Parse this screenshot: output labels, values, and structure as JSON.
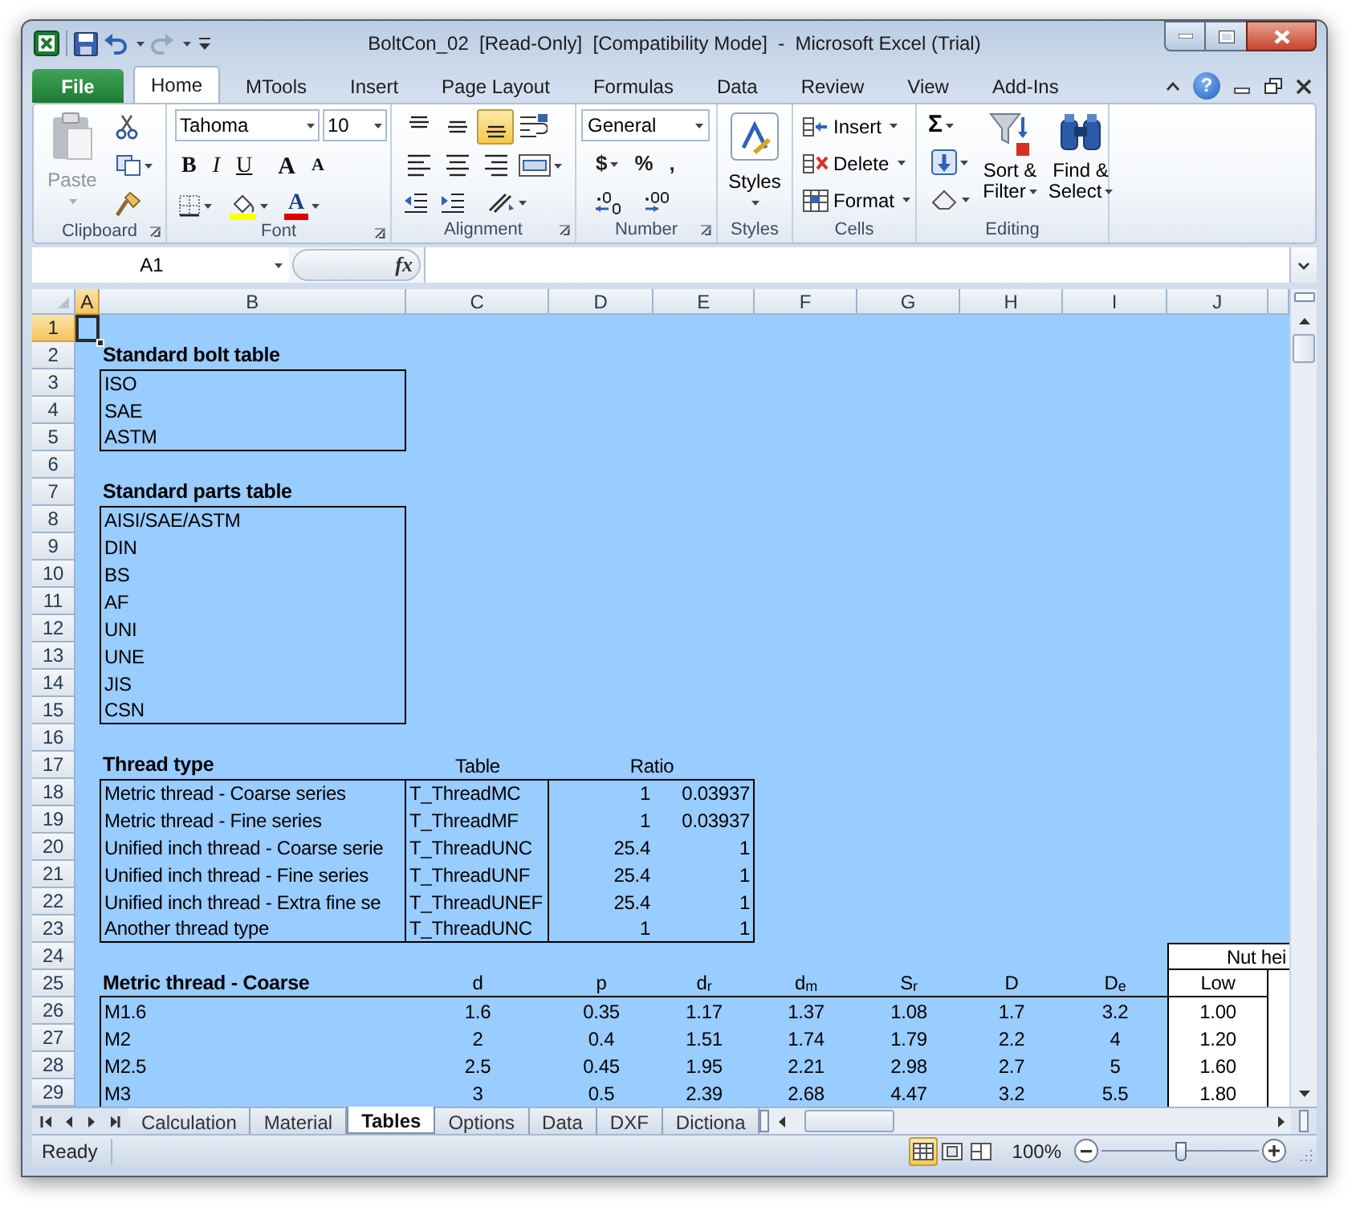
{
  "window": {
    "title": "BoltCon_02  [Read-Only]  [Compatibility Mode]  -  Microsoft Excel (Trial)"
  },
  "ribbon_tabs": [
    {
      "label": "File",
      "kind": "file",
      "selected": false
    },
    {
      "label": "Home",
      "kind": "tab",
      "selected": true
    },
    {
      "label": "MTools",
      "kind": "tab",
      "selected": false
    },
    {
      "label": "Insert",
      "kind": "tab",
      "selected": false
    },
    {
      "label": "Page Layout",
      "kind": "tab",
      "selected": false
    },
    {
      "label": "Formulas",
      "kind": "tab",
      "selected": false
    },
    {
      "label": "Data",
      "kind": "tab",
      "selected": false
    },
    {
      "label": "Review",
      "kind": "tab",
      "selected": false
    },
    {
      "label": "View",
      "kind": "tab",
      "selected": false
    },
    {
      "label": "Add-Ins",
      "kind": "tab",
      "selected": false
    }
  ],
  "help_button": "?",
  "ribbon": {
    "groups": [
      {
        "label": "Clipboard"
      },
      {
        "label": "Font"
      },
      {
        "label": "Alignment"
      },
      {
        "label": "Number"
      },
      {
        "label": "Styles"
      },
      {
        "label": "Cells"
      },
      {
        "label": "Editing"
      }
    ],
    "paste": {
      "label": "Paste",
      "disabled": true
    },
    "font_name": "Tahoma",
    "font_size": "10",
    "font_buttons": [
      {
        "label": "B",
        "kind": "bold"
      },
      {
        "label": "I",
        "kind": "italic"
      },
      {
        "label": "U",
        "kind": "underline"
      },
      {
        "label": "A",
        "kind": "grow"
      },
      {
        "label": "A",
        "kind": "shrink"
      }
    ],
    "font_color_button": "A",
    "vertical_align": [
      {
        "kind": "top",
        "on": false
      },
      {
        "kind": "middle",
        "on": false
      },
      {
        "kind": "bottom",
        "on": true
      }
    ],
    "number_format": "General",
    "number_buttons": [
      {
        "label": "$",
        "kind": "currency"
      },
      {
        "label": "%",
        "kind": "percent"
      },
      {
        "label": ",",
        "kind": "comma"
      }
    ],
    "styles": "Styles",
    "cells_buttons": [
      {
        "label": "Insert",
        "kind": "insert"
      },
      {
        "label": "Delete",
        "kind": "delete"
      },
      {
        "label": "Format",
        "kind": "format"
      }
    ],
    "sum_button": "Σ",
    "editing_buttons": [
      {
        "label": "Sort & Filter",
        "kind": "sort"
      },
      {
        "label": "Find & Select",
        "kind": "find"
      }
    ]
  },
  "formula_bar": {
    "name_box": "A1",
    "function_label": "fx"
  },
  "columns": [
    {
      "label": "A",
      "selected": true
    },
    {
      "label": "B",
      "selected": false
    },
    {
      "label": "C",
      "selected": false
    },
    {
      "label": "D",
      "selected": false
    },
    {
      "label": "E",
      "selected": false
    },
    {
      "label": "F",
      "selected": false
    },
    {
      "label": "G",
      "selected": false
    },
    {
      "label": "H",
      "selected": false
    },
    {
      "label": "I",
      "selected": false
    },
    {
      "label": "J",
      "selected": false
    }
  ],
  "rows": [
    {
      "number": "1",
      "selected": true
    },
    {
      "number": "2",
      "selected": false,
      "B": {
        "text": "Standard bolt table",
        "bold": true
      }
    },
    {
      "number": "3",
      "selected": false,
      "B": {
        "text": "ISO"
      }
    },
    {
      "number": "4",
      "selected": false,
      "B": {
        "text": "SAE"
      }
    },
    {
      "number": "5",
      "selected": false,
      "B": {
        "text": "ASTM"
      }
    },
    {
      "number": "6",
      "selected": false
    },
    {
      "number": "7",
      "selected": false,
      "B": {
        "text": "Standard parts table",
        "bold": true
      }
    },
    {
      "number": "8",
      "selected": false,
      "B": {
        "text": "AISI/SAE/ASTM"
      }
    },
    {
      "number": "9",
      "selected": false,
      "B": {
        "text": "DIN"
      }
    },
    {
      "number": "10",
      "selected": false,
      "B": {
        "text": "BS"
      }
    },
    {
      "number": "11",
      "selected": false,
      "B": {
        "text": "AF"
      }
    },
    {
      "number": "12",
      "selected": false,
      "B": {
        "text": "UNI"
      }
    },
    {
      "number": "13",
      "selected": false,
      "B": {
        "text": "UNE"
      }
    },
    {
      "number": "14",
      "selected": false,
      "B": {
        "text": "JIS"
      }
    },
    {
      "number": "15",
      "selected": false,
      "B": {
        "text": "CSN"
      }
    },
    {
      "number": "16",
      "selected": false
    },
    {
      "number": "17",
      "selected": false,
      "B": {
        "text": "Thread type",
        "bold": true
      },
      "C": {
        "text": "Table",
        "centered": true
      },
      "D": {
        "text": "Ratio",
        "centered": true,
        "merged": true
      }
    },
    {
      "number": "18",
      "selected": false,
      "B": {
        "text": "Metric thread - Coarse series"
      },
      "C": {
        "text": "T_ThreadMC"
      },
      "D": {
        "text": "1",
        "right_aligned": true
      },
      "E": {
        "text": "0.03937",
        "right_aligned": true
      }
    },
    {
      "number": "19",
      "selected": false,
      "B": {
        "text": "Metric thread - Fine series"
      },
      "C": {
        "text": "T_ThreadMF"
      },
      "D": {
        "text": "1",
        "right_aligned": true
      },
      "E": {
        "text": "0.03937",
        "right_aligned": true
      }
    },
    {
      "number": "20",
      "selected": false,
      "B": {
        "text": "Unified inch thread - Coarse serie"
      },
      "C": {
        "text": "T_ThreadUNC"
      },
      "D": {
        "text": "25.4",
        "right_aligned": true
      },
      "E": {
        "text": "1",
        "right_aligned": true
      }
    },
    {
      "number": "21",
      "selected": false,
      "B": {
        "text": "Unified inch thread - Fine series"
      },
      "C": {
        "text": "T_ThreadUNF"
      },
      "D": {
        "text": "25.4",
        "right_aligned": true
      },
      "E": {
        "text": "1",
        "right_aligned": true
      }
    },
    {
      "number": "22",
      "selected": false,
      "B": {
        "text": "Unified inch thread - Extra fine se"
      },
      "C": {
        "text": "T_ThreadUNEF"
      },
      "D": {
        "text": "25.4",
        "right_aligned": true
      },
      "E": {
        "text": "1",
        "right_aligned": true
      }
    },
    {
      "number": "23",
      "selected": false,
      "B": {
        "text": "Another thread type"
      },
      "C": {
        "text": "T_ThreadUNC"
      },
      "D": {
        "text": "1",
        "right_aligned": true
      },
      "E": {
        "text": "1",
        "right_aligned": true
      }
    },
    {
      "number": "24",
      "selected": false,
      "J": {
        "text": "Nut hei",
        "right_aligned": true,
        "merged": true
      }
    },
    {
      "number": "25",
      "selected": false,
      "B": {
        "text": "Metric thread - Coarse",
        "bold": true
      },
      "C": {
        "text": "d",
        "centered": true
      },
      "D": {
        "text": "p",
        "centered": true
      },
      "E": {
        "text": "d$_{r}$",
        "centered": true
      },
      "F": {
        "text": "d$_{m}$",
        "centered": true
      },
      "G": {
        "text": "S$_{r}$",
        "centered": true
      },
      "H": {
        "text": "D",
        "centered": true
      },
      "I": {
        "text": "D$_{e}$",
        "centered": true
      },
      "J": {
        "text": "Low",
        "centered": true
      }
    },
    {
      "number": "26",
      "selected": false,
      "B": {
        "text": "M1.6"
      },
      "C": {
        "text": "1.6",
        "centered": true
      },
      "D": {
        "text": "0.35",
        "centered": true
      },
      "E": {
        "text": "1.17",
        "centered": true
      },
      "F": {
        "text": "1.37",
        "centered": true
      },
      "G": {
        "text": "1.08",
        "centered": true
      },
      "H": {
        "text": "1.7",
        "centered": true
      },
      "I": {
        "text": "3.2",
        "centered": true
      },
      "J": {
        "text": "1.00",
        "centered": true
      }
    },
    {
      "number": "27",
      "selected": false,
      "B": {
        "text": "M2"
      },
      "C": {
        "text": "2",
        "centered": true
      },
      "D": {
        "text": "0.4",
        "centered": true
      },
      "E": {
        "text": "1.51",
        "centered": true
      },
      "F": {
        "text": "1.74",
        "centered": true
      },
      "G": {
        "text": "1.79",
        "centered": true
      },
      "H": {
        "text": "2.2",
        "centered": true
      },
      "I": {
        "text": "4",
        "centered": true
      },
      "J": {
        "text": "1.20",
        "centered": true
      }
    },
    {
      "number": "28",
      "selected": false,
      "B": {
        "text": "M2.5"
      },
      "C": {
        "text": "2.5",
        "centered": true
      },
      "D": {
        "text": "0.45",
        "centered": true
      },
      "E": {
        "text": "1.95",
        "centered": true
      },
      "F": {
        "text": "2.21",
        "centered": true
      },
      "G": {
        "text": "2.98",
        "centered": true
      },
      "H": {
        "text": "2.7",
        "centered": true
      },
      "I": {
        "text": "5",
        "centered": true
      },
      "J": {
        "text": "1.60",
        "centered": true
      }
    },
    {
      "number": "29",
      "selected": false,
      "B": {
        "text": "M3"
      },
      "C": {
        "text": "3",
        "centered": true
      },
      "D": {
        "text": "0.5",
        "centered": true
      },
      "E": {
        "text": "2.39",
        "centered": true
      },
      "F": {
        "text": "2.68",
        "centered": true
      },
      "G": {
        "text": "4.47",
        "centered": true
      },
      "H": {
        "text": "3.2",
        "centered": true
      },
      "I": {
        "text": "5.5",
        "centered": true
      },
      "J": {
        "text": "1.80",
        "centered": true
      }
    }
  ],
  "sheet_tabs": [
    {
      "label": "Calculation",
      "selected": false
    },
    {
      "label": "Material",
      "selected": false
    },
    {
      "label": "Tables",
      "selected": true
    },
    {
      "label": "Options",
      "selected": false
    },
    {
      "label": "Data",
      "selected": false
    },
    {
      "label": "DXF",
      "selected": false
    },
    {
      "label": "Dictiona",
      "selected": false
    }
  ],
  "status_bar": {
    "mode": "Ready",
    "views": [
      {
        "kind": "normal",
        "selected": true
      },
      {
        "kind": "page_layout",
        "selected": false
      },
      {
        "kind": "page_break",
        "selected": false
      }
    ],
    "zoom": {
      "reading": "100%",
      "level": 0.5
    }
  }
}
